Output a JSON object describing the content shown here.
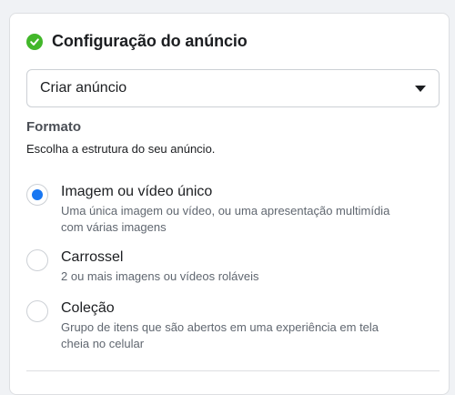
{
  "section": {
    "title": "Configuração do anúncio",
    "status_icon": "check-circle-icon",
    "status_color": "#42b72a"
  },
  "ad_select": {
    "selected": "Criar anúncio",
    "icon": "caret-down-icon"
  },
  "format": {
    "title": "Formato",
    "subtitle": "Escolha a estrutura do seu anúncio.",
    "options": [
      {
        "label": "Imagem ou vídeo único",
        "description_lines": [
          "Uma única imagem ou vídeo, ou uma apresentação multimídia",
          "com várias imagens"
        ],
        "selected": true
      },
      {
        "label": "Carrossel",
        "description_lines": [
          "2 ou mais imagens ou vídeos roláveis"
        ],
        "selected": false
      },
      {
        "label": "Coleção",
        "description_lines": [
          "Grupo de itens que são abertos em uma experiência em tela",
          "cheia no celular"
        ],
        "selected": false
      }
    ]
  },
  "colors": {
    "accent": "#1877f2",
    "success": "#42b72a"
  }
}
